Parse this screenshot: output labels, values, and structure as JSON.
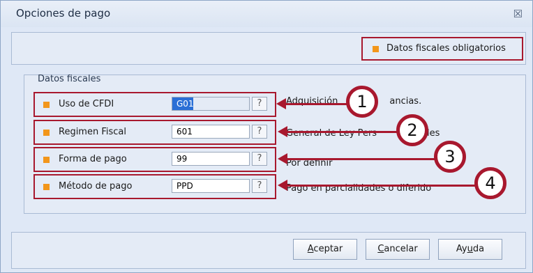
{
  "window": {
    "title": "Opciones de pago",
    "close_glyph": "☒"
  },
  "legend": {
    "text": "Datos fiscales obligatorios",
    "marker_color": "#f2961b"
  },
  "group": {
    "title": "Datos fiscales",
    "rows": [
      {
        "label": "Uso de CFDI",
        "value": "G01",
        "selected": true,
        "description": "Adquisición",
        "description_tail": "ancias.",
        "callout": "1"
      },
      {
        "label": "Regimen Fiscal",
        "value": "601",
        "selected": false,
        "description": "General de Ley Pers",
        "description_tail": "ales",
        "callout": "2"
      },
      {
        "label": "Forma de pago",
        "value": "99",
        "selected": false,
        "description": "Por definir",
        "description_tail": "",
        "callout": "3"
      },
      {
        "label": "Método de pago",
        "value": "PPD",
        "selected": false,
        "description": "Pago en parcialidades o diferido",
        "description_tail": "",
        "callout": "4"
      }
    ],
    "help_glyph": "?"
  },
  "buttons": {
    "accept": {
      "mnemonic": "A",
      "rest": "ceptar"
    },
    "cancel": {
      "mnemonic": "C",
      "rest": "ancelar"
    },
    "help": {
      "pre": "Ay",
      "mnemonic": "u",
      "rest": "da"
    }
  },
  "colors": {
    "annotation": "#a8182e",
    "required_marker": "#f2961b",
    "selection": "#2a6fd6"
  }
}
